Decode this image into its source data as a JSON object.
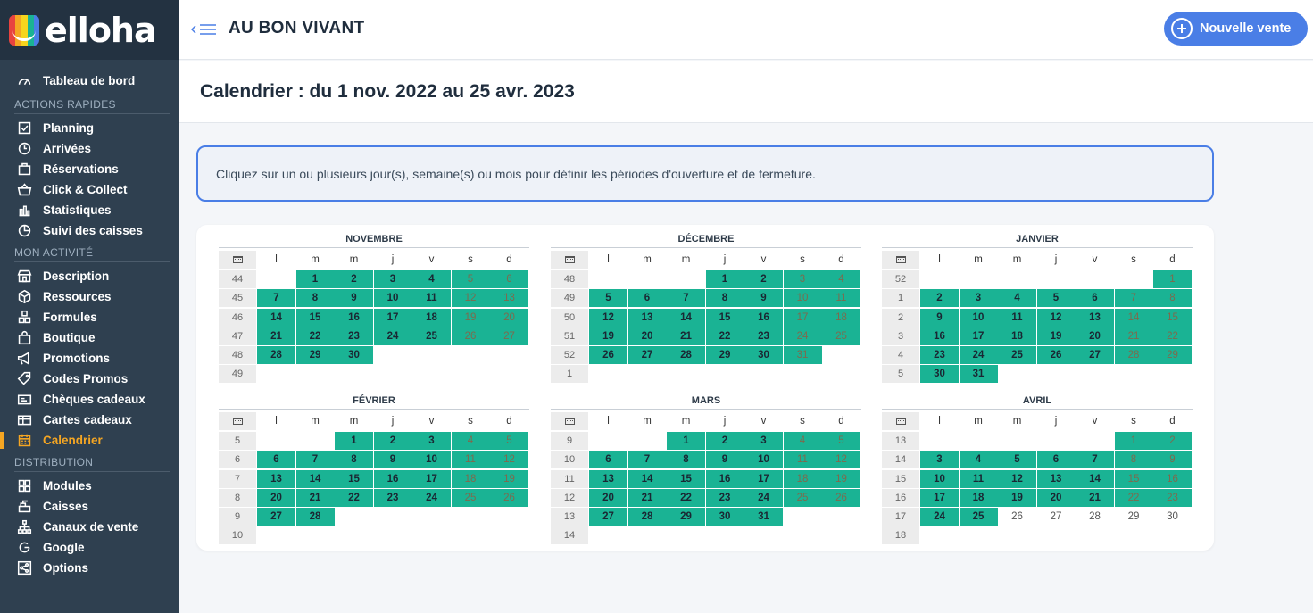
{
  "app": {
    "logo_text": "elloha",
    "logo_colors": [
      "#e8433f",
      "#f5a623",
      "#f7d51d",
      "#1ab394",
      "#4a7ee6"
    ]
  },
  "sidebar": {
    "top_item": {
      "label": "Tableau de bord",
      "icon": "dashboard-icon"
    },
    "sections": [
      {
        "title": "ACTIONS RAPIDES",
        "items": [
          {
            "label": "Planning",
            "icon": "checklist-icon"
          },
          {
            "label": "Arrivées",
            "icon": "clock-icon"
          },
          {
            "label": "Réservations",
            "icon": "suitcase-icon"
          },
          {
            "label": "Click & Collect",
            "icon": "basket-icon"
          },
          {
            "label": "Statistiques",
            "icon": "bar-chart-icon"
          },
          {
            "label": "Suivi des caisses",
            "icon": "pie-chart-icon"
          }
        ]
      },
      {
        "title": "MON ACTIVITÉ",
        "items": [
          {
            "label": "Description",
            "icon": "store-icon"
          },
          {
            "label": "Ressources",
            "icon": "box-icon"
          },
          {
            "label": "Formules",
            "icon": "cubes-icon"
          },
          {
            "label": "Boutique",
            "icon": "shopping-bag-icon"
          },
          {
            "label": "Promotions",
            "icon": "megaphone-icon"
          },
          {
            "label": "Codes Promos",
            "icon": "tag-icon"
          },
          {
            "label": "Chèques cadeaux",
            "icon": "voucher-icon"
          },
          {
            "label": "Cartes cadeaux",
            "icon": "gift-card-icon"
          },
          {
            "label": "Calendrier",
            "icon": "calendar-icon",
            "active": true
          }
        ]
      },
      {
        "title": "DISTRIBUTION",
        "items": [
          {
            "label": "Modules",
            "icon": "grid-icon"
          },
          {
            "label": "Caisses",
            "icon": "cash-register-icon"
          },
          {
            "label": "Canaux de vente",
            "icon": "sitemap-icon"
          },
          {
            "label": "Google",
            "icon": "google-icon"
          },
          {
            "label": "Options",
            "icon": "share-icon"
          }
        ]
      }
    ]
  },
  "header": {
    "shop_name": "AU BON VIVANT",
    "new_sale_label": "Nouvelle vente"
  },
  "page": {
    "title": "Calendrier : du 1 nov. 2022 au 25 avr. 2023",
    "info": "Cliquez sur un ou plusieurs jour(s), semaine(s) ou mois pour définir les périodes d'ouverture et de fermeture."
  },
  "calendar": {
    "day_headers": [
      "l",
      "m",
      "m",
      "j",
      "v",
      "s",
      "d"
    ],
    "open_color": "#1ab394",
    "months": [
      {
        "name": "NOVEMBRE",
        "offset": 1,
        "days": 30,
        "weeks": [
          "44",
          "45",
          "46",
          "47",
          "48",
          "49"
        ],
        "open_until": 30
      },
      {
        "name": "DÉCEMBRE",
        "offset": 3,
        "days": 31,
        "weeks": [
          "48",
          "49",
          "50",
          "51",
          "52",
          "1"
        ],
        "open_until": 31
      },
      {
        "name": "JANVIER",
        "offset": 6,
        "days": 31,
        "weeks": [
          "52",
          "1",
          "2",
          "3",
          "4",
          "5"
        ],
        "open_until": 31
      },
      {
        "name": "FÉVRIER",
        "offset": 2,
        "days": 28,
        "weeks": [
          "5",
          "6",
          "7",
          "8",
          "9",
          "10"
        ],
        "open_until": 28
      },
      {
        "name": "MARS",
        "offset": 2,
        "days": 31,
        "weeks": [
          "9",
          "10",
          "11",
          "12",
          "13",
          "14"
        ],
        "open_until": 31
      },
      {
        "name": "AVRIL",
        "offset": 5,
        "days": 30,
        "weeks": [
          "13",
          "14",
          "15",
          "16",
          "17",
          "18"
        ],
        "open_until": 25
      }
    ]
  }
}
